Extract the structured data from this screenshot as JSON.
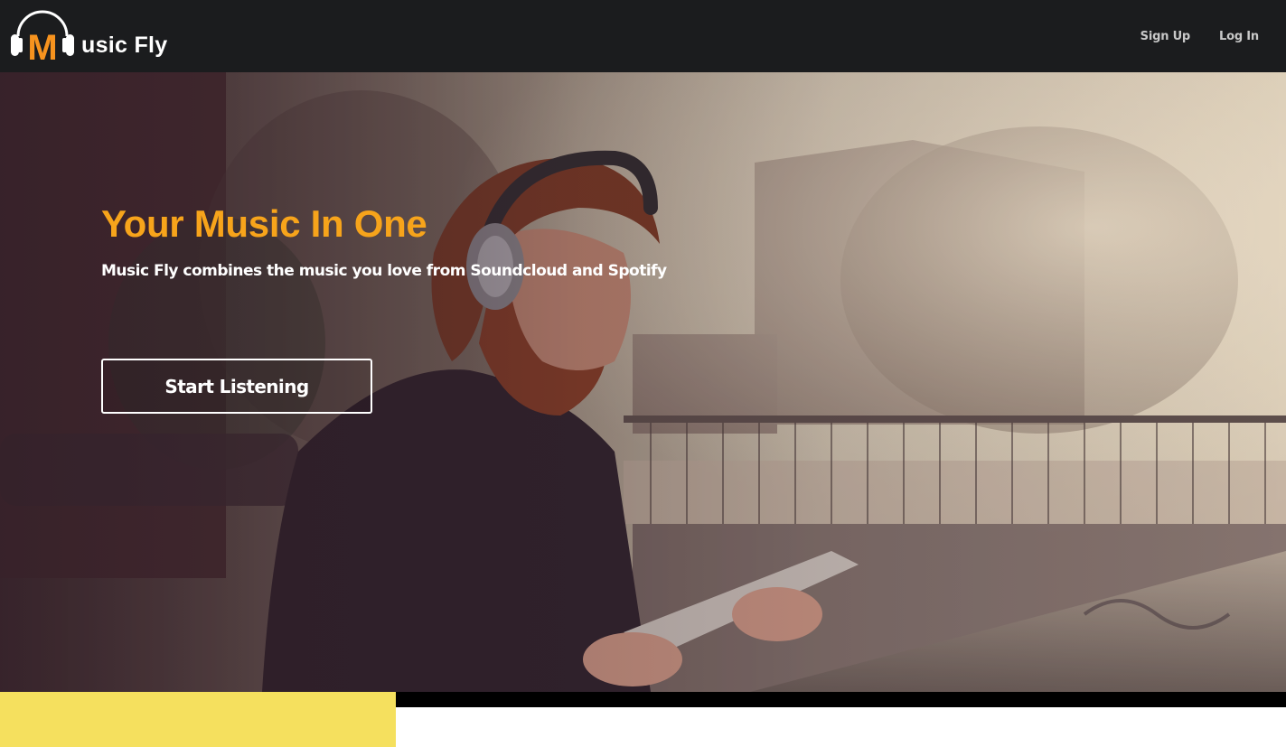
{
  "navbar": {
    "logo": {
      "letter": "M",
      "text": "usic Fly",
      "icon": "headphones-icon"
    },
    "links": [
      {
        "label": "Sign Up"
      },
      {
        "label": "Log In"
      }
    ]
  },
  "hero": {
    "title": "Your Music In One",
    "subtitle": "Music Fly combines the music you love from Soundcloud and Spotify",
    "cta_label": "Start Listening",
    "background": "photo-man-with-headphones-and-tablet"
  },
  "colors": {
    "navbar_bg": "#1b1c1e",
    "accent_orange": "#f7a41b",
    "nav_link": "#c8c8c8",
    "footer_yellow": "#f5e05e"
  }
}
